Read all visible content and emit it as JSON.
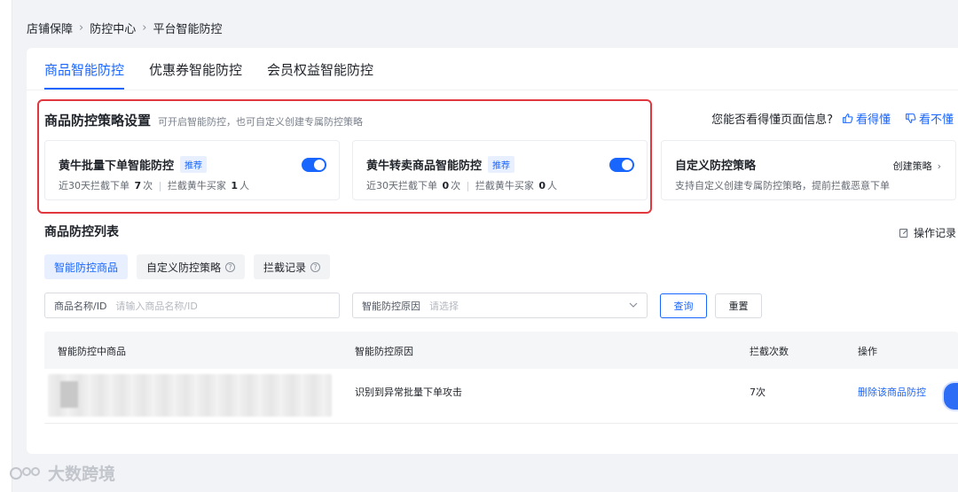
{
  "breadcrumb": [
    "店铺保障",
    "防控中心",
    "平台智能防控"
  ],
  "tabs": [
    "商品智能防控",
    "优惠券智能防控",
    "会员权益智能防控"
  ],
  "strategy": {
    "title": "商品防控策略设置",
    "subtitle": "可开启智能防控，也可自定义创建专属防控策略"
  },
  "feedback": {
    "question": "您能否看得懂页面信息?",
    "yes": "看得懂",
    "no": "看不懂"
  },
  "cards": [
    {
      "title": "黄牛批量下单智能防控",
      "badge": "推荐",
      "stat_prefix": "近30天拦截下单",
      "count1": "7",
      "unit1": "次",
      "stat2_prefix": "拦截黄牛买家",
      "count2": "1",
      "unit2": "人",
      "enabled": true
    },
    {
      "title": "黄牛转卖商品智能防控",
      "badge": "推荐",
      "stat_prefix": "近30天拦截下单",
      "count1": "0",
      "unit1": "次",
      "stat2_prefix": "拦截黄牛买家",
      "count2": "0",
      "unit2": "人",
      "enabled": true
    }
  ],
  "custom_card": {
    "title": "自定义防控策略",
    "link": "创建策略",
    "desc": "支持自定义创建专属防控策略，提前拦截恶意下单"
  },
  "list": {
    "title": "商品防控列表",
    "op_log": "操作记录"
  },
  "subtabs": [
    "智能防控商品",
    "自定义防控策略",
    "拦截记录"
  ],
  "filters": {
    "name_label": "商品名称/ID",
    "name_placeholder": "请输入商品名称/ID",
    "reason_label": "智能防控原因",
    "reason_placeholder": "请选择",
    "query": "查询",
    "reset": "重置"
  },
  "table": {
    "headers": [
      "智能防控中商品",
      "智能防控原因",
      "拦截次数",
      "操作"
    ],
    "rows": [
      {
        "reason": "识别到异常批量下单攻击",
        "count": "7次",
        "action": "删除该商品防控"
      }
    ]
  },
  "watermark": "大数跨境",
  "colors": {
    "accent": "#1966ff",
    "highlight": "#e0383e"
  }
}
